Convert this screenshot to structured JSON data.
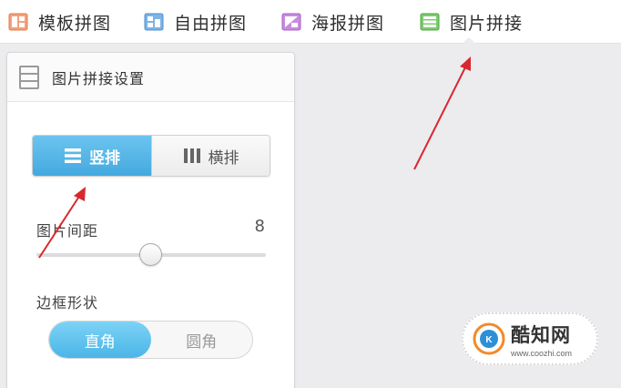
{
  "nav": {
    "items": [
      {
        "label": "模板拼图",
        "icon": "template-collage-icon"
      },
      {
        "label": "自由拼图",
        "icon": "free-collage-icon"
      },
      {
        "label": "海报拼图",
        "icon": "poster-collage-icon"
      },
      {
        "label": "图片拼接",
        "icon": "image-stitch-icon",
        "active": true
      }
    ]
  },
  "panel": {
    "title": "图片拼接设置",
    "icon": "list-icon",
    "layout": {
      "vertical_label": "竖排",
      "horizontal_label": "横排",
      "selected": "竖排"
    },
    "spacing": {
      "label": "图片间距",
      "value": "8"
    },
    "border_shape": {
      "label": "边框形状",
      "square_label": "直角",
      "round_label": "圆角",
      "selected": "直角"
    }
  },
  "watermark": {
    "name": "酷知网",
    "url": "www.coozhi.com"
  },
  "colors": {
    "accent": "#4ab6e7",
    "annotation": "#d8282f"
  }
}
